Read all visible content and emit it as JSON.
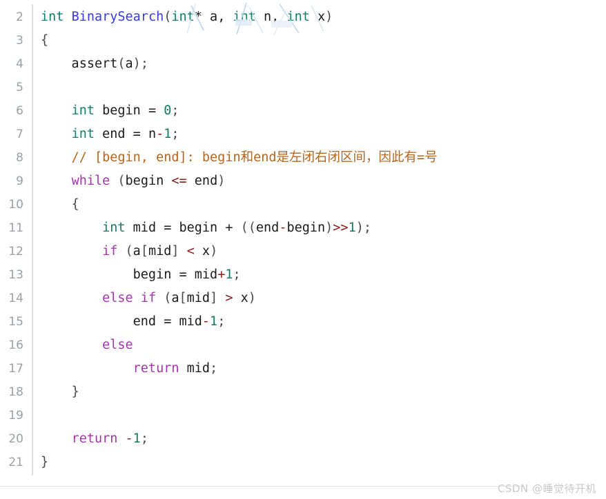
{
  "editor": {
    "language": "C",
    "first_line_number": 2,
    "background_color": "#ffffff",
    "gutter_color": "#9aa0a6",
    "gutter_divider_color": "#dcdddf"
  },
  "theme": {
    "plain": "#1b1b1b",
    "type": "#0f8068",
    "keyword": "#a436ac",
    "function": "#3a3ae0",
    "comment": "#b5651d",
    "number": "#0f7a5f",
    "operator": "#8b1a1a",
    "punctuation": "#4a4a4a",
    "artifact": "#bcd8ef"
  },
  "lines": [
    {
      "number": "2",
      "tokens": [
        {
          "text": "int",
          "kind": "type"
        },
        {
          "text": " ",
          "kind": "plain"
        },
        {
          "text": "BinarySearch",
          "kind": "func"
        },
        {
          "text": "(",
          "kind": "punct"
        },
        {
          "text": "int",
          "kind": "type"
        },
        {
          "text": "* a, ",
          "kind": "plain"
        },
        {
          "text": "int",
          "kind": "type"
        },
        {
          "text": " n, ",
          "kind": "plain"
        },
        {
          "text": "int",
          "kind": "type"
        },
        {
          "text": " x",
          "kind": "plain"
        },
        {
          "text": ")",
          "kind": "punct"
        }
      ]
    },
    {
      "number": "3",
      "tokens": [
        {
          "text": "{",
          "kind": "punct"
        }
      ]
    },
    {
      "number": "4",
      "tokens": [
        {
          "text": "    assert",
          "kind": "plain"
        },
        {
          "text": "(",
          "kind": "punct"
        },
        {
          "text": "a",
          "kind": "plain"
        },
        {
          "text": ")",
          "kind": "punct"
        },
        {
          "text": ";",
          "kind": "punct"
        }
      ]
    },
    {
      "number": "5",
      "tokens": []
    },
    {
      "number": "6",
      "tokens": [
        {
          "text": "    ",
          "kind": "plain"
        },
        {
          "text": "int",
          "kind": "type"
        },
        {
          "text": " begin = ",
          "kind": "plain"
        },
        {
          "text": "0",
          "kind": "number"
        },
        {
          "text": ";",
          "kind": "punct"
        }
      ]
    },
    {
      "number": "7",
      "tokens": [
        {
          "text": "    ",
          "kind": "plain"
        },
        {
          "text": "int",
          "kind": "type"
        },
        {
          "text": " end = n",
          "kind": "plain"
        },
        {
          "text": "-",
          "kind": "op"
        },
        {
          "text": "1",
          "kind": "number"
        },
        {
          "text": ";",
          "kind": "punct"
        }
      ]
    },
    {
      "number": "8",
      "tokens": [
        {
          "text": "    ",
          "kind": "plain"
        },
        {
          "text": "// [begin, end]: begin",
          "kind": "comment"
        },
        {
          "text": "和",
          "kind": "comment-cjk"
        },
        {
          "text": "end",
          "kind": "comment"
        },
        {
          "text": "是左闭右闭区间，因此有",
          "kind": "comment-cjk"
        },
        {
          "text": "=",
          "kind": "comment"
        },
        {
          "text": "号",
          "kind": "comment-cjk"
        }
      ]
    },
    {
      "number": "9",
      "tokens": [
        {
          "text": "    ",
          "kind": "plain"
        },
        {
          "text": "while",
          "kind": "keyword"
        },
        {
          "text": " ",
          "kind": "plain"
        },
        {
          "text": "(",
          "kind": "punct"
        },
        {
          "text": "begin ",
          "kind": "plain"
        },
        {
          "text": "<=",
          "kind": "op"
        },
        {
          "text": " end",
          "kind": "plain"
        },
        {
          "text": ")",
          "kind": "punct"
        }
      ]
    },
    {
      "number": "10",
      "tokens": [
        {
          "text": "    ",
          "kind": "plain"
        },
        {
          "text": "{",
          "kind": "punct"
        }
      ]
    },
    {
      "number": "11",
      "tokens": [
        {
          "text": "        ",
          "kind": "plain"
        },
        {
          "text": "int",
          "kind": "type"
        },
        {
          "text": " mid = begin + ",
          "kind": "plain"
        },
        {
          "text": "((",
          "kind": "punct"
        },
        {
          "text": "end",
          "kind": "plain"
        },
        {
          "text": "-",
          "kind": "op"
        },
        {
          "text": "begin",
          "kind": "plain"
        },
        {
          "text": ")",
          "kind": "punct"
        },
        {
          "text": ">>",
          "kind": "op"
        },
        {
          "text": "1",
          "kind": "number"
        },
        {
          "text": ")",
          "kind": "punct"
        },
        {
          "text": ";",
          "kind": "punct"
        }
      ]
    },
    {
      "number": "12",
      "tokens": [
        {
          "text": "        ",
          "kind": "plain"
        },
        {
          "text": "if",
          "kind": "keyword"
        },
        {
          "text": " ",
          "kind": "plain"
        },
        {
          "text": "(",
          "kind": "punct"
        },
        {
          "text": "a",
          "kind": "plain"
        },
        {
          "text": "[",
          "kind": "punct"
        },
        {
          "text": "mid",
          "kind": "plain"
        },
        {
          "text": "]",
          "kind": "punct"
        },
        {
          "text": " ",
          "kind": "plain"
        },
        {
          "text": "<",
          "kind": "op"
        },
        {
          "text": " x",
          "kind": "plain"
        },
        {
          "text": ")",
          "kind": "punct"
        }
      ]
    },
    {
      "number": "13",
      "tokens": [
        {
          "text": "            begin = mid",
          "kind": "plain"
        },
        {
          "text": "+",
          "kind": "op"
        },
        {
          "text": "1",
          "kind": "number"
        },
        {
          "text": ";",
          "kind": "punct"
        }
      ]
    },
    {
      "number": "14",
      "tokens": [
        {
          "text": "        ",
          "kind": "plain"
        },
        {
          "text": "else",
          "kind": "keyword"
        },
        {
          "text": " ",
          "kind": "plain"
        },
        {
          "text": "if",
          "kind": "keyword"
        },
        {
          "text": " ",
          "kind": "plain"
        },
        {
          "text": "(",
          "kind": "punct"
        },
        {
          "text": "a",
          "kind": "plain"
        },
        {
          "text": "[",
          "kind": "punct"
        },
        {
          "text": "mid",
          "kind": "plain"
        },
        {
          "text": "]",
          "kind": "punct"
        },
        {
          "text": " ",
          "kind": "plain"
        },
        {
          "text": ">",
          "kind": "op"
        },
        {
          "text": " x",
          "kind": "plain"
        },
        {
          "text": ")",
          "kind": "punct"
        }
      ]
    },
    {
      "number": "15",
      "tokens": [
        {
          "text": "            end = mid",
          "kind": "plain"
        },
        {
          "text": "-",
          "kind": "op"
        },
        {
          "text": "1",
          "kind": "number"
        },
        {
          "text": ";",
          "kind": "punct"
        }
      ]
    },
    {
      "number": "16",
      "tokens": [
        {
          "text": "        ",
          "kind": "plain"
        },
        {
          "text": "else",
          "kind": "keyword"
        }
      ]
    },
    {
      "number": "17",
      "tokens": [
        {
          "text": "            ",
          "kind": "plain"
        },
        {
          "text": "return",
          "kind": "keyword"
        },
        {
          "text": " mid",
          "kind": "plain"
        },
        {
          "text": ";",
          "kind": "punct"
        }
      ]
    },
    {
      "number": "18",
      "tokens": [
        {
          "text": "    ",
          "kind": "plain"
        },
        {
          "text": "}",
          "kind": "punct"
        }
      ]
    },
    {
      "number": "19",
      "tokens": []
    },
    {
      "number": "20",
      "tokens": [
        {
          "text": "    ",
          "kind": "plain"
        },
        {
          "text": "return",
          "kind": "keyword"
        },
        {
          "text": " ",
          "kind": "plain"
        },
        {
          "text": "-",
          "kind": "op"
        },
        {
          "text": "1",
          "kind": "number"
        },
        {
          "text": ";",
          "kind": "punct"
        }
      ]
    },
    {
      "number": "21",
      "tokens": [
        {
          "text": "}",
          "kind": "punct"
        }
      ]
    }
  ],
  "watermark": {
    "text": "CSDN @睡觉待开机"
  }
}
